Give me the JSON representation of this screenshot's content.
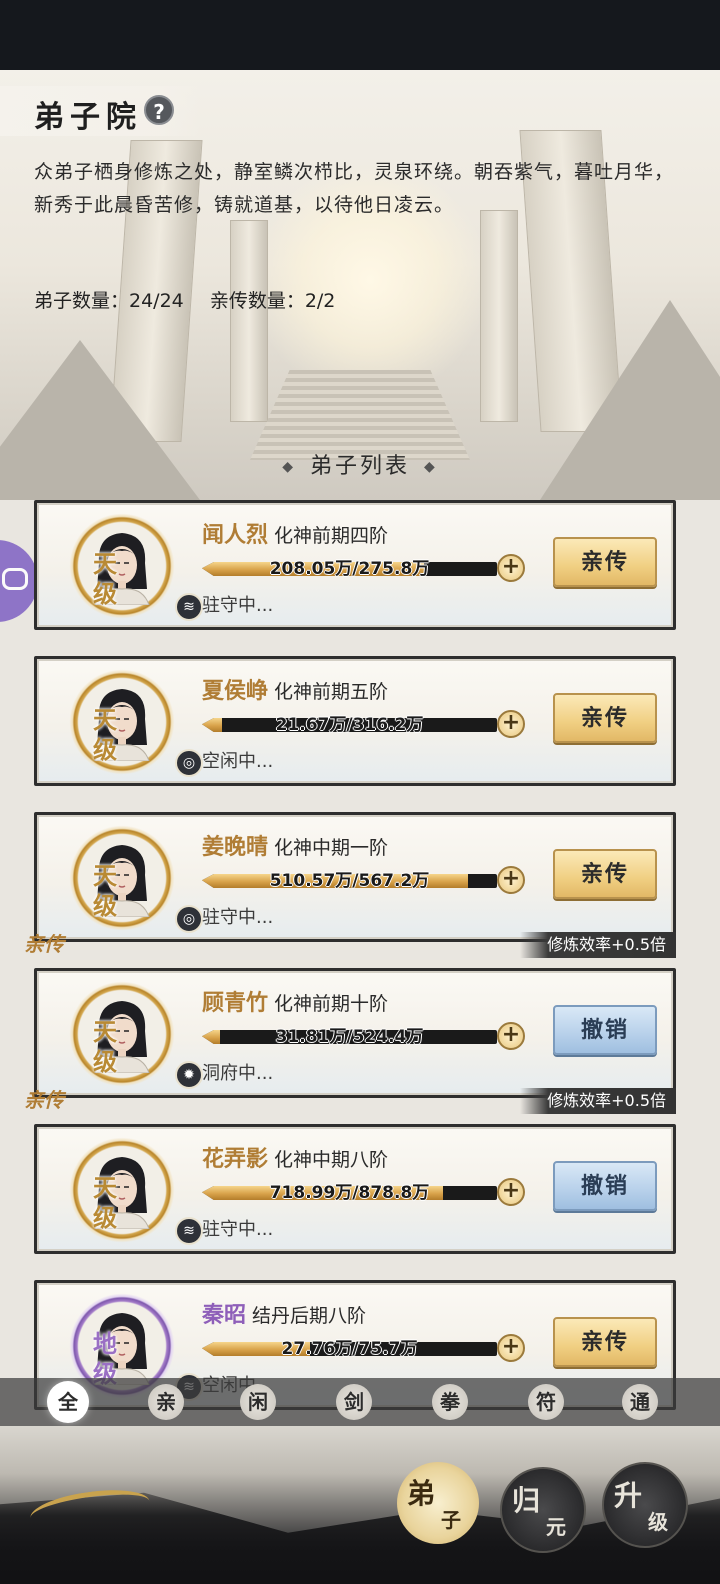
{
  "header": {
    "title": "弟子院",
    "help_icon": "?",
    "description": "众弟子栖身修炼之处，静室鳞次栉比，灵泉环绕。朝吞紫气，暮吐月华，新秀于此晨昏苦修，铸就道基，以待他日凌云。",
    "disciple_count": "弟子数量：24/24",
    "personal_count": "亲传数量：2/2"
  },
  "list_title": "弟子列表",
  "list_title_ornament": "◆",
  "cards": [
    {
      "grade": "天级",
      "name": "闻人烈",
      "rank": "化神前期四阶",
      "progress": "208.05万/275.8万",
      "progress_fraction": 0.754,
      "status": "驻守中...",
      "button": "亲传",
      "element": "water"
    },
    {
      "grade": "天级",
      "name": "夏侯峥",
      "rank": "化神前期五阶",
      "progress": "21.67万/316.2万",
      "progress_fraction": 0.069,
      "status": "空闲中...",
      "button": "亲传",
      "element": "wind"
    },
    {
      "grade": "天级",
      "name": "姜晚晴",
      "rank": "化神中期一阶",
      "progress": "510.57万/567.2万",
      "progress_fraction": 0.9,
      "status": "驻守中...",
      "button": "亲传",
      "element": "wind"
    },
    {
      "grade": "天级",
      "name": "顾青竹",
      "rank": "化神前期十阶",
      "progress": "31.81万/524.4万",
      "progress_fraction": 0.061,
      "status": "洞府中...",
      "button": "撤销",
      "element": "fire",
      "tag": "亲传",
      "buff": "修炼效率+0.5倍"
    },
    {
      "grade": "天级",
      "name": "花弄影",
      "rank": "化神中期八阶",
      "progress": "718.99万/878.8万",
      "progress_fraction": 0.818,
      "status": "驻守中...",
      "button": "撤销",
      "element": "water",
      "tag": "亲传",
      "buff": "修炼效率+0.5倍"
    },
    {
      "grade": "地级",
      "name": "秦昭",
      "rank": "结丹后期八阶",
      "progress": "27.76万/75.7万",
      "progress_fraction": 0.367,
      "status": "空闲中...",
      "button": "亲传",
      "element": "water"
    }
  ],
  "plus_label": "+",
  "filters": [
    "全",
    "亲",
    "闲",
    "剑",
    "拳",
    "符",
    "通"
  ],
  "active_filter": "全",
  "bottom_nav": [
    {
      "a": "弟",
      "b": "子"
    },
    {
      "a": "归",
      "b": "元"
    },
    {
      "a": "升",
      "b": "级"
    }
  ],
  "colors": {
    "gold": "#b07d35",
    "purple": "#8e5fb9",
    "button_gold": "#f0cf82",
    "button_blue": "#b7d0ea"
  }
}
